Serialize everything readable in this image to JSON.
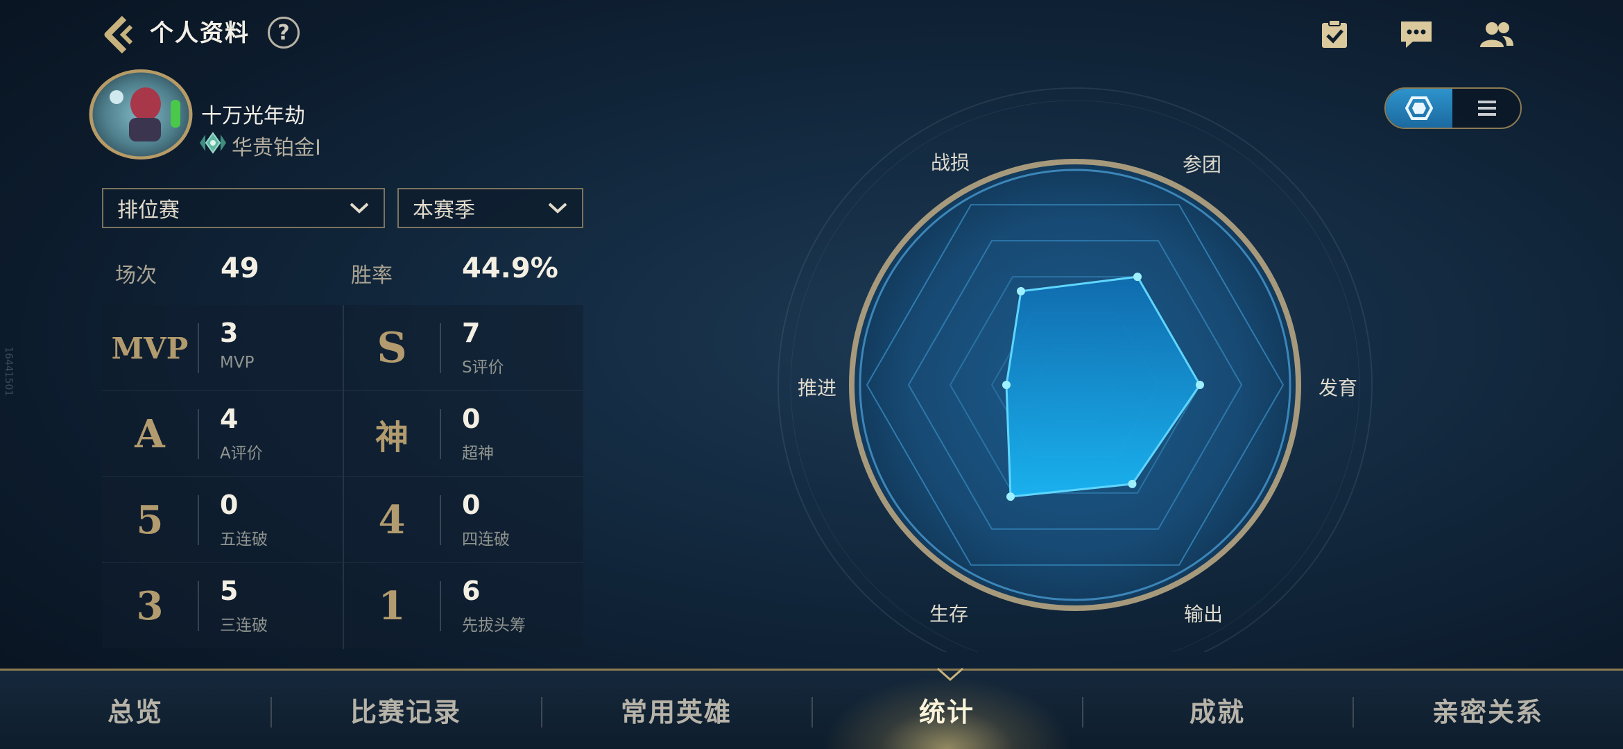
{
  "header": {
    "title": "个人资料",
    "help_label": "?"
  },
  "profile": {
    "name": "十万光年劫",
    "rank": "华贵铂金Ⅰ"
  },
  "filters": {
    "mode": "排位赛",
    "season": "本赛季"
  },
  "summary": {
    "matches_label": "场次",
    "matches_value": "49",
    "winrate_label": "胜率",
    "winrate_value": "44.9%"
  },
  "stats": [
    {
      "emblem": "MVP",
      "value": "3",
      "label": "MVP"
    },
    {
      "emblem": "S",
      "value": "7",
      "label": "S评价"
    },
    {
      "emblem": "A",
      "value": "4",
      "label": "A评价"
    },
    {
      "emblem": "神",
      "value": "0",
      "label": "超神"
    },
    {
      "emblem": "5",
      "value": "0",
      "label": "五连破"
    },
    {
      "emblem": "4",
      "value": "0",
      "label": "四连破"
    },
    {
      "emblem": "3",
      "value": "5",
      "label": "三连破"
    },
    {
      "emblem": "1",
      "value": "6",
      "label": "先拔头筹"
    }
  ],
  "radar": {
    "axes": [
      "参团",
      "发育",
      "输出",
      "生存",
      "推进",
      "战损"
    ],
    "values": [
      0.6,
      0.6,
      0.55,
      0.62,
      0.33,
      0.52
    ]
  },
  "tabs": [
    "总览",
    "比赛记录",
    "常用英雄",
    "统计",
    "成就",
    "亲密关系"
  ],
  "active_tab": "统计",
  "side_code": "16441501",
  "colors": {
    "gold": "#b29b6e",
    "radar_fill": "#1aa8ee",
    "accent_blue": "#2e93cc"
  }
}
